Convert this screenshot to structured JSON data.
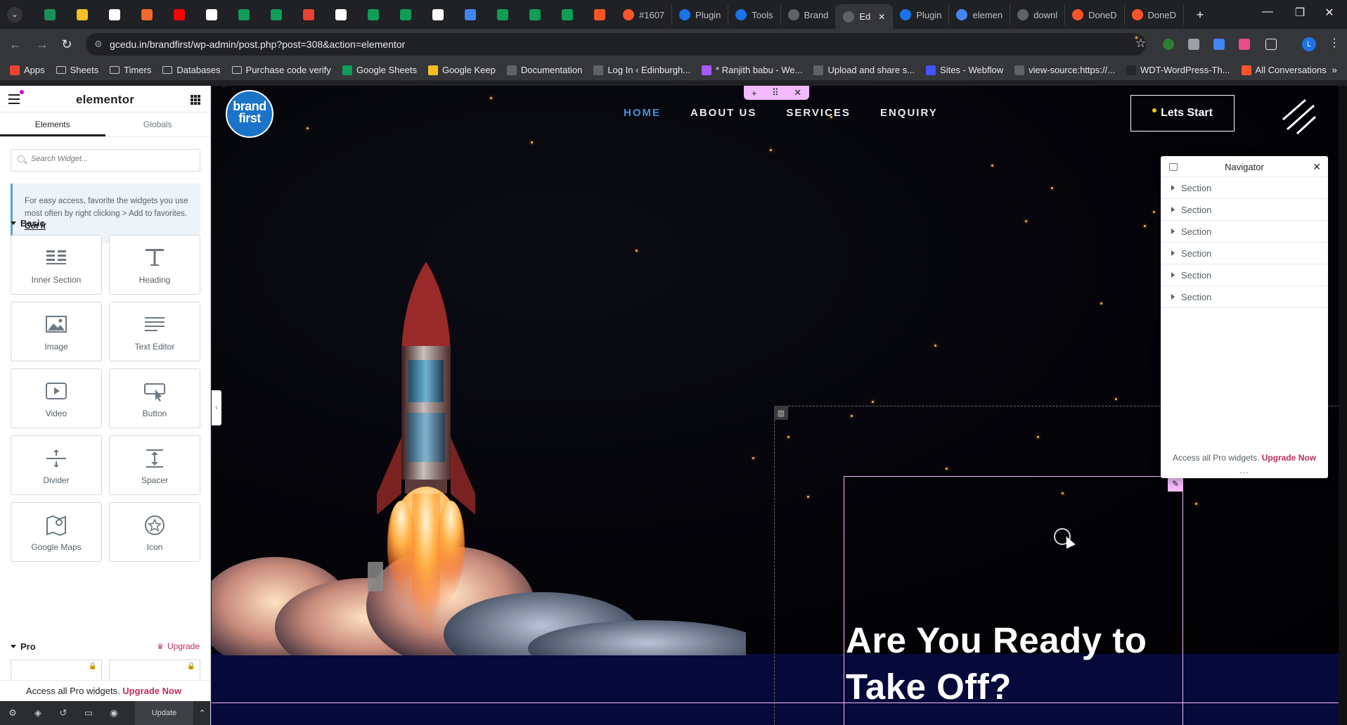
{
  "browser": {
    "tabs": [
      {
        "icon": "dropdown-icon"
      },
      {
        "icon": "google-analytics-icon",
        "color": "#1b8f5a"
      },
      {
        "icon": "keep-icon",
        "color": "#f6bf26"
      },
      {
        "icon": "wordpress-icon",
        "color": "#ffffff"
      },
      {
        "icon": "brand-orange-icon",
        "color": "#ef6a2f"
      },
      {
        "icon": "youtube-icon",
        "color": "#ff0000"
      },
      {
        "icon": "medium-icon",
        "color": "#ffffff"
      },
      {
        "icon": "sheets-icon",
        "color": "#0f9d58"
      },
      {
        "icon": "sheets-icon",
        "color": "#0f9d58"
      },
      {
        "icon": "gmail-icon",
        "color": "#ea4335"
      },
      {
        "icon": "chatgpt-icon",
        "color": "#ffffff"
      },
      {
        "icon": "sheets-icon",
        "color": "#0f9d58"
      },
      {
        "icon": "sheets-icon",
        "color": "#0f9d58"
      },
      {
        "icon": "webflow-icon",
        "color": "#ffffff"
      },
      {
        "icon": "chrome-icon",
        "color": "#4285f4"
      },
      {
        "icon": "sheets-icon",
        "color": "#0f9d58"
      },
      {
        "icon": "sheets-icon",
        "color": "#0f9d58"
      },
      {
        "icon": "sheets-icon",
        "color": "#0f9d58"
      },
      {
        "icon": "brave-icon",
        "color": "#fb542b"
      }
    ],
    "labeled_tabs": [
      {
        "label": "#1607",
        "color": "#fb542b"
      },
      {
        "label": "Plugin",
        "color": "#1a73e8"
      },
      {
        "label": "Tools",
        "color": "#1a73e8"
      },
      {
        "label": "Brand",
        "color": "#5f6368"
      },
      {
        "label": "Ed",
        "color": "#5f6368",
        "active": true
      },
      {
        "label": "Plugin",
        "color": "#1a73e8"
      },
      {
        "label": "elemen",
        "color": "#4285f4"
      },
      {
        "label": "downl",
        "color": "#5f6368"
      },
      {
        "label": "DoneD",
        "color": "#fb542b"
      },
      {
        "label": "DoneD",
        "color": "#fb542b"
      }
    ],
    "new_tab": "+",
    "url": "gcedu.in/brandfirst/wp-admin/post.php?post=308&action=elementor",
    "profile_initial": "L",
    "bookmarks": [
      {
        "label": "Apps",
        "icon": "apps-icon",
        "color": "#ea4335"
      },
      {
        "label": "Sheets",
        "icon": "folder-icon"
      },
      {
        "label": "Timers",
        "icon": "folder-icon"
      },
      {
        "label": "Databases",
        "icon": "folder-icon"
      },
      {
        "label": "Purchase code verify",
        "icon": "folder-icon"
      },
      {
        "label": "Google Sheets",
        "icon": "sheets-icon",
        "color": "#0f9d58"
      },
      {
        "label": "Google Keep",
        "icon": "keep-icon",
        "color": "#f6bf26"
      },
      {
        "label": "Documentation",
        "icon": "globe-icon",
        "color": "#5f6368"
      },
      {
        "label": "Log In ‹ Edinburgh...",
        "icon": "globe-icon",
        "color": "#5f6368"
      },
      {
        "label": "* Ranjith babu - We...",
        "icon": "figma-icon",
        "color": "#a259ff"
      },
      {
        "label": "Upload and share s...",
        "icon": "sb-icon",
        "color": "#5f6368"
      },
      {
        "label": "Sites - Webflow",
        "icon": "webflow-icon",
        "color": "#4353ff"
      },
      {
        "label": "view-source:https://...",
        "icon": "globe-icon",
        "color": "#5f6368"
      },
      {
        "label": "WDT-WordPress-Th...",
        "icon": "github-icon",
        "color": "#24292e"
      },
      {
        "label": "All Conversations",
        "icon": "brave-icon",
        "color": "#fb542b"
      }
    ],
    "more_bookmarks": "»"
  },
  "panel": {
    "title": "elementor",
    "tabs": [
      "Elements",
      "Globals"
    ],
    "search_placeholder": "Search Widget...",
    "tip_text": "For easy access, favorite the widgets you use most often by right clicking > Add to favorites.",
    "tip_link": "Got It",
    "basic_title": "Basic",
    "widgets": [
      {
        "label": "Inner Section",
        "icon": "inner-section-icon"
      },
      {
        "label": "Heading",
        "icon": "heading-icon"
      },
      {
        "label": "Image",
        "icon": "image-icon"
      },
      {
        "label": "Text Editor",
        "icon": "text-editor-icon"
      },
      {
        "label": "Video",
        "icon": "video-icon"
      },
      {
        "label": "Button",
        "icon": "button-icon"
      },
      {
        "label": "Divider",
        "icon": "divider-icon"
      },
      {
        "label": "Spacer",
        "icon": "spacer-icon"
      },
      {
        "label": "Google Maps",
        "icon": "google-maps-icon"
      },
      {
        "label": "Icon",
        "icon": "star-icon"
      }
    ],
    "pro_title": "Pro",
    "upgrade_label": "Upgrade",
    "promo_text": "Access all Pro widgets.",
    "promo_link": "Upgrade Now",
    "update_label": "Update"
  },
  "site": {
    "logo_line1": "brand",
    "logo_line2": "first",
    "nav": [
      "HOME",
      "ABOUT US",
      "SERVICES",
      "ENQUIRY"
    ],
    "nav_active": "HOME",
    "cta_label": "Lets Start",
    "heading": "Are You Ready to Take Off?"
  },
  "navigator": {
    "title": "Navigator",
    "items": [
      "Section",
      "Section",
      "Section",
      "Section",
      "Section",
      "Section"
    ],
    "promo_text": "Access all Pro widgets.",
    "promo_link": "Upgrade Now",
    "resize": "..."
  },
  "colors": {
    "brand_accent": "#c02b62",
    "editor_pink": "#f3bafd",
    "nav_active": "#4c8fd6",
    "logo_blue": "#1a73c9"
  }
}
